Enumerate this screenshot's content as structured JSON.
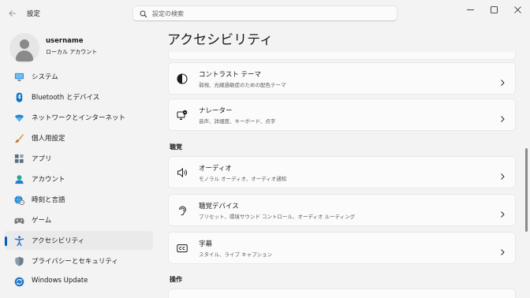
{
  "titlebar": {
    "app_title": "設定",
    "search_placeholder": "設定の検索"
  },
  "profile": {
    "name": "username",
    "account_type": "ローカル アカウント"
  },
  "sidebar": {
    "items": [
      {
        "label": "システム",
        "icon": "monitor-icon"
      },
      {
        "label": "Bluetooth とデバイス",
        "icon": "bluetooth-icon"
      },
      {
        "label": "ネットワークとインターネット",
        "icon": "wifi-icon"
      },
      {
        "label": "個人用設定",
        "icon": "brush-icon"
      },
      {
        "label": "アプリ",
        "icon": "apps-icon"
      },
      {
        "label": "アカウント",
        "icon": "account-icon"
      },
      {
        "label": "時刻と言語",
        "icon": "globe-clock-icon"
      },
      {
        "label": "ゲーム",
        "icon": "gamepad-icon"
      },
      {
        "label": "アクセシビリティ",
        "icon": "accessibility-icon",
        "active": true
      },
      {
        "label": "プライバシーとセキュリティ",
        "icon": "shield-icon"
      },
      {
        "label": "Windows Update",
        "icon": "update-icon"
      }
    ]
  },
  "main": {
    "page_title": "アクセシビリティ",
    "cards_top": [
      {
        "title": "コントラスト テーマ",
        "subtitle": "弱視、光線過敏症のための配色テーマ",
        "icon": "contrast-icon"
      },
      {
        "title": "ナレーター",
        "subtitle": "音声、詳細度、キーボード、点字",
        "icon": "narrator-icon"
      }
    ],
    "section_hearing": "聴覚",
    "cards_hearing": [
      {
        "title": "オーディオ",
        "subtitle": "モノラル オーディオ、オーディオ通知",
        "icon": "speaker-icon"
      },
      {
        "title": "聴覚デバイス",
        "subtitle": "プリセット、環境サウンド コントロール、オーディオ ルーティング",
        "icon": "ear-icon"
      },
      {
        "title": "字幕",
        "subtitle": "スタイル、ライブ キャプション",
        "icon": "cc-icon"
      }
    ],
    "section_interaction": "操作"
  },
  "colors": {
    "accent": "#005fb8",
    "background": "#f3f3f3",
    "card": "#fbfbfb"
  }
}
